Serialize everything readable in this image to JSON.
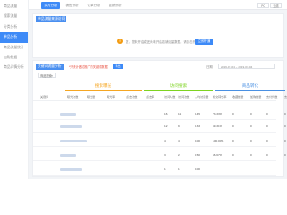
{
  "sidebar": {
    "items": [
      {
        "label": "商品流量",
        "active": false
      },
      {
        "label": "搜索流量",
        "active": false
      },
      {
        "label": "分类分析",
        "active": false
      },
      {
        "label": "单品分析",
        "active": true
      },
      {
        "label": "商品流量统计",
        "active": false
      },
      {
        "label": "加购数据",
        "active": false
      },
      {
        "label": "商品详情分析",
        "active": false
      }
    ]
  },
  "topbar": {
    "tabs": [
      {
        "label": "实时分析",
        "active": true
      },
      {
        "label": "销售分析",
        "active": false
      },
      {
        "label": "订单分析",
        "active": false
      },
      {
        "label": "促销分析",
        "active": false
      }
    ],
    "device_buttons": [
      "PC",
      "无线"
    ]
  },
  "source_card": {
    "title": "单品流量来源访问",
    "notice_icon": "!",
    "notice_text": "您，您未开启或还尚未开启店铺流量数据，请点击开启",
    "button_label": "立即开通"
  },
  "table_card": {
    "title": "关键词流量分析",
    "note": "*只统计做过推广的关键词数据",
    "export_label": "导出",
    "date_label": "日期：",
    "date_range": "2019-07-04 ~ 2019-07-04",
    "filter": {
      "value": "商品搜索"
    },
    "groups": [
      {
        "label": "搜索曝光",
        "color": "#f5a623"
      },
      {
        "label": "访问搜索",
        "color": "#7ed321"
      },
      {
        "label": "商品转化",
        "color": "#4a90e2"
      }
    ],
    "columns": [
      "关键词",
      "曝光次数",
      "曝光量",
      "曝光率",
      "点击次数",
      "点击率",
      "访问人数",
      "访问次数",
      "人均访问量",
      "成交转化率",
      "收藏数量",
      "加购数量",
      "支付件数",
      "支付买家数"
    ],
    "rows": [
      {
        "cells": [
          "",
          "",
          "",
          "",
          "16",
          "11",
          "1.45",
          "73.33%",
          "0",
          "0",
          "0",
          "0"
        ]
      },
      {
        "cells": [
          "",
          "",
          "",
          "",
          "12",
          "9",
          "1.33",
          "69.31%",
          "0",
          "0",
          "0",
          "0"
        ]
      },
      {
        "cells": [
          "",
          "",
          "",
          "",
          "4",
          "4",
          "1.00",
          "100.00%",
          "0",
          "0",
          "0",
          "0"
        ]
      },
      {
        "cells": [
          "",
          "",
          "",
          "",
          "3",
          "2",
          "1.50",
          "66.67%",
          "0",
          "0",
          "0",
          "0"
        ]
      },
      {
        "cells": [
          "",
          "",
          "",
          "",
          "1",
          "1",
          "1.00",
          "",
          "",
          "",
          "",
          ""
        ]
      }
    ]
  },
  "colors": {
    "accent": "#3d8af7",
    "warning": "#f39c12",
    "note": "#e74c3c"
  }
}
